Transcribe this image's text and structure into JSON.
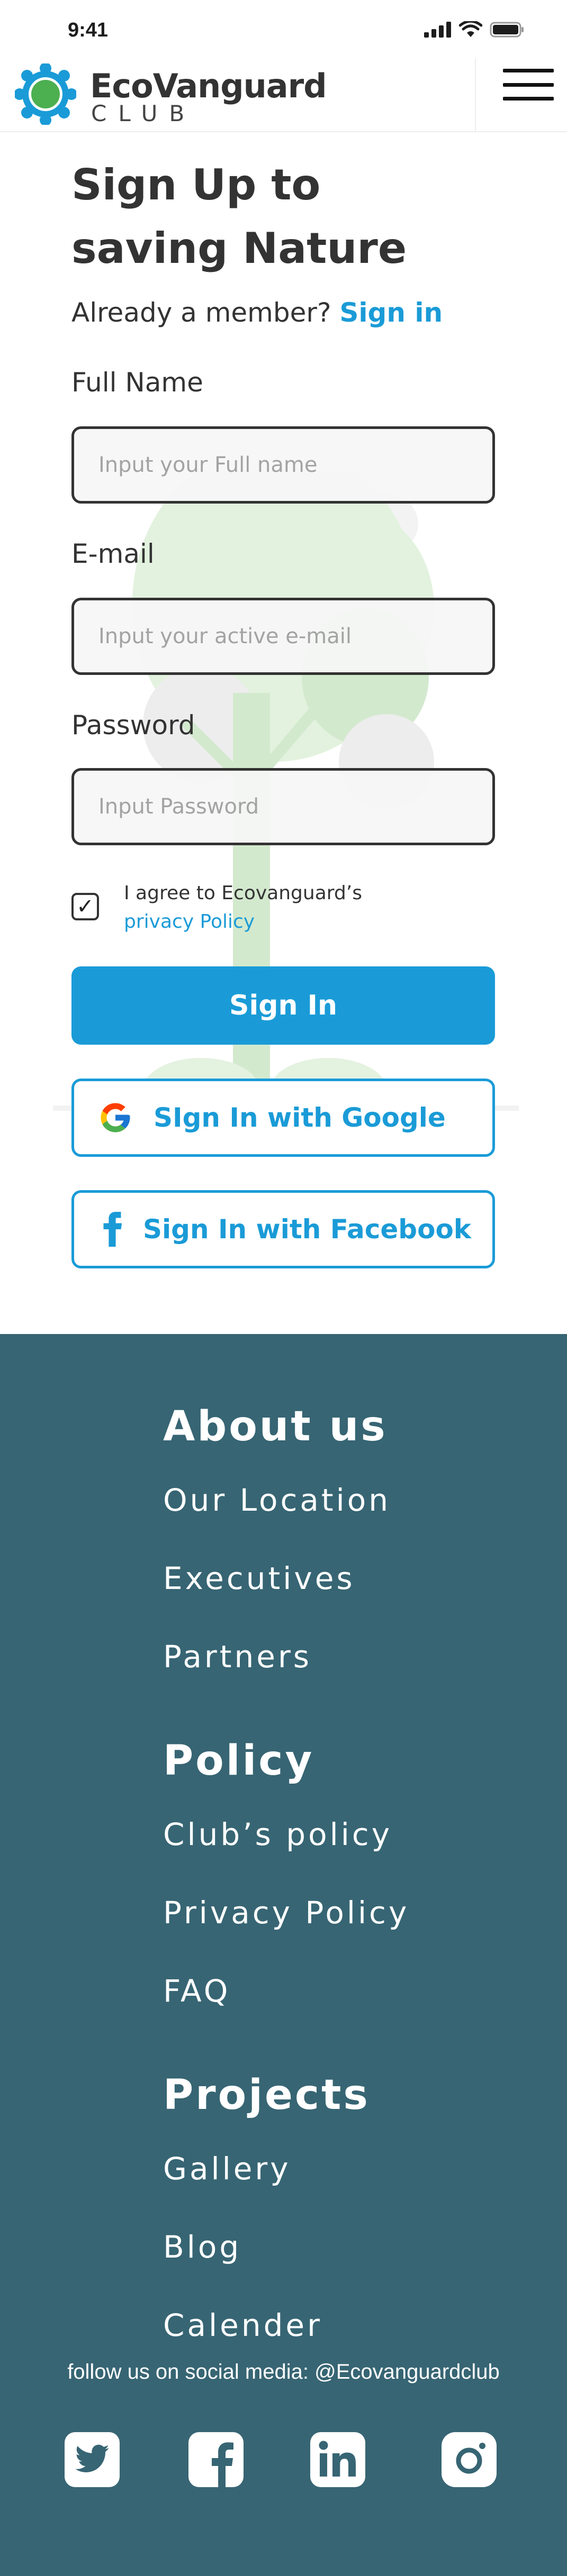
{
  "status_bar": {
    "time": "9:41"
  },
  "header": {
    "brand_name": "EcoVanguard",
    "brand_sub": "CLUB"
  },
  "form": {
    "title": "Sign Up to saving Nature",
    "member_prompt": "Already a member?",
    "sign_in_link": "Sign in",
    "full_name_label": "Full Name",
    "full_name_placeholder": "Input your Full name",
    "email_label": "E-mail",
    "email_placeholder": "Input your active e-mail",
    "password_label": "Password",
    "password_placeholder": "Input Password",
    "agree_text": "I agree to Ecovanguard’s",
    "agree_link": "privacy Policy",
    "checkbox_mark": "✓",
    "sign_in_button": "Sign In",
    "google_button": "SIgn In with Google",
    "facebook_button": "Sign In with Facebook"
  },
  "footer": {
    "sections": [
      {
        "heading": "About us",
        "links": [
          "Our Location",
          "Executives",
          "Partners"
        ]
      },
      {
        "heading": "Policy",
        "links": [
          "Club’s policy",
          "Privacy Policy",
          "FAQ"
        ]
      },
      {
        "heading": "Projects",
        "links": [
          "Gallery",
          "Blog",
          "Calender"
        ]
      }
    ],
    "social_text": "follow us on social media: @Ecovanguardclub",
    "social_icons": [
      "twitter-icon",
      "facebook-icon",
      "linkedin-icon",
      "instagram-icon"
    ]
  },
  "colors": {
    "accent": "#1a9bd7",
    "footer_bg": "#376573",
    "text": "#333333",
    "logo_green": "#4caf50"
  }
}
